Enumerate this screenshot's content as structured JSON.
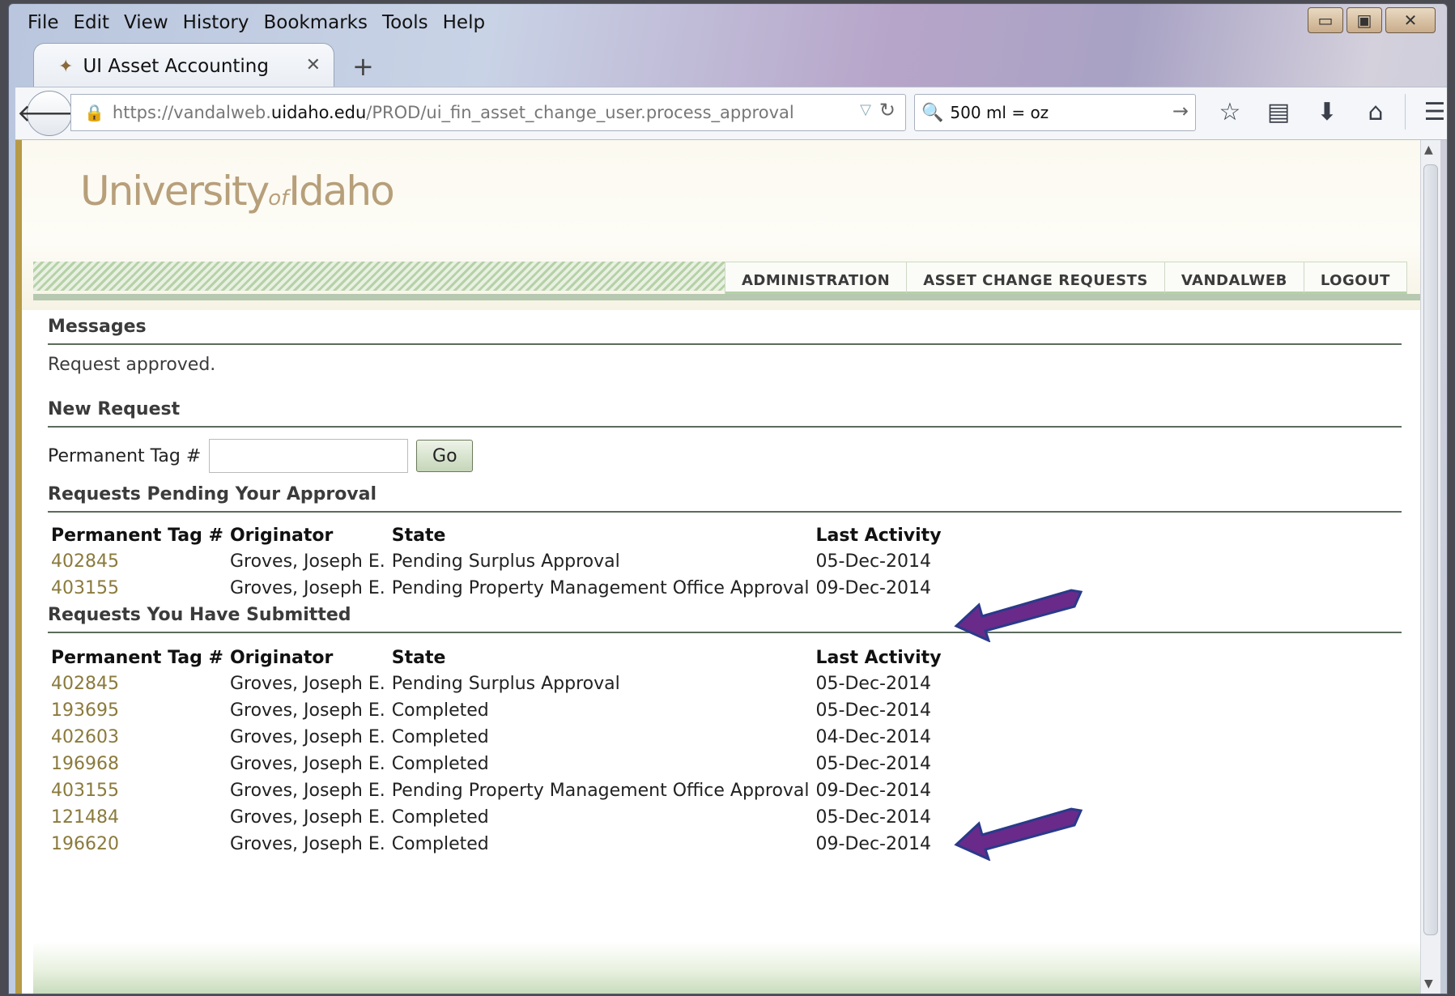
{
  "browser": {
    "menu": [
      {
        "label": "File"
      },
      {
        "label": "Edit"
      },
      {
        "label": "View"
      },
      {
        "label": "History"
      },
      {
        "label": "Bookmarks"
      },
      {
        "label": "Tools"
      },
      {
        "label": "Help"
      }
    ],
    "window_controls": {
      "minimize": "▭",
      "maximize": "▣",
      "close": "✕"
    },
    "tab": {
      "title": "UI Asset Accounting",
      "close": "✕"
    },
    "new_tab": "+",
    "url": {
      "prefix": "https://vandalweb.",
      "domain": "uidaho.edu",
      "path": "/PROD/ui_fin_asset_change_user.process_approval"
    },
    "search_value": "500 ml = oz",
    "toolbar_icons": [
      "star-icon",
      "reading-list-icon",
      "download-icon",
      "home-icon",
      "menu-icon"
    ]
  },
  "site": {
    "logo": {
      "part1": "University",
      "part2": "of",
      "part3": "Idaho"
    },
    "nav": [
      {
        "label": "ADMINISTRATION"
      },
      {
        "label": "ASSET CHANGE REQUESTS"
      },
      {
        "label": "VANDALWEB"
      },
      {
        "label": "LOGOUT"
      }
    ]
  },
  "messages": {
    "heading": "Messages",
    "text": "Request approved."
  },
  "new_request": {
    "heading": "New Request",
    "label": "Permanent Tag #",
    "value": "",
    "button": "Go"
  },
  "pending": {
    "heading": "Requests Pending Your Approval",
    "columns": [
      "Permanent Tag #",
      "Originator",
      "State",
      "Last Activity"
    ],
    "rows": [
      {
        "tag": "402845",
        "originator": "Groves, Joseph E.",
        "state": "Pending Surplus Approval",
        "last": "05-Dec-2014"
      },
      {
        "tag": "403155",
        "originator": "Groves, Joseph E.",
        "state": "Pending Property Management Office Approval",
        "last": "09-Dec-2014"
      }
    ]
  },
  "submitted": {
    "heading": "Requests You Have Submitted",
    "columns": [
      "Permanent Tag #",
      "Originator",
      "State",
      "Last Activity"
    ],
    "rows": [
      {
        "tag": "402845",
        "originator": "Groves, Joseph E.",
        "state": "Pending Surplus Approval",
        "last": "05-Dec-2014"
      },
      {
        "tag": "193695",
        "originator": "Groves, Joseph E.",
        "state": "Completed",
        "last": "05-Dec-2014"
      },
      {
        "tag": "402603",
        "originator": "Groves, Joseph E.",
        "state": "Completed",
        "last": "04-Dec-2014"
      },
      {
        "tag": "196968",
        "originator": "Groves, Joseph E.",
        "state": "Completed",
        "last": "05-Dec-2014"
      },
      {
        "tag": "403155",
        "originator": "Groves, Joseph E.",
        "state": "Pending Property Management Office Approval",
        "last": "09-Dec-2014"
      },
      {
        "tag": "121484",
        "originator": "Groves, Joseph E.",
        "state": "Completed",
        "last": "05-Dec-2014"
      },
      {
        "tag": "196620",
        "originator": "Groves, Joseph E.",
        "state": "Completed",
        "last": "09-Dec-2014"
      }
    ]
  },
  "colors": {
    "link": "#8a7a3c",
    "arrow": "#6a2a8a",
    "arrow_outline": "#2a3a8a",
    "accent_gold": "#b79a45"
  }
}
